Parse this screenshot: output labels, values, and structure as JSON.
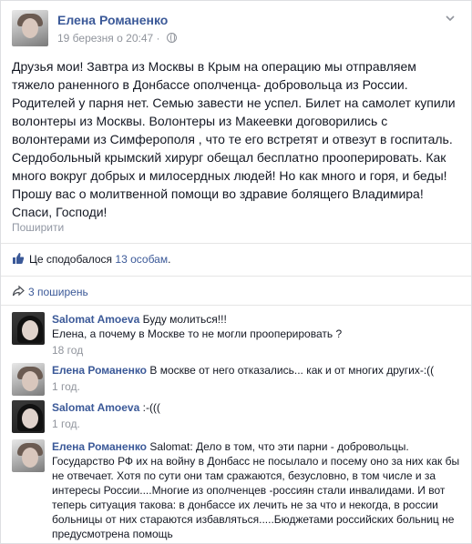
{
  "post": {
    "author": "Елена Романенко",
    "date": "19 березня о 20:47",
    "date_separator": "·",
    "text": "Друзья мои! Завтра из Москвы в Крым на операцию мы отправляем тяжело раненного в Донбассе ополченца- добровольца из России. Родителей у парня нет. Семью завести не успел. Билет на самолет купили волонтеры из Москвы. Волонтеры из Макеевки договорились с волонтерами из Симферополя , что те его встретят и отвезут в госпиталь. Сердобольный крымский хирург обещал бесплатно прооперировать. Как много вокруг добрых и милосердных людей! Но как много и горя, и беды! Прошу вас о молитвенной помощи во здравие болящего Владимира! Спаси, Господи!",
    "translate_label": "Поширити"
  },
  "likes": {
    "prefix": "Це сподобалося",
    "link": "13 особам",
    "suffix": "."
  },
  "shares": {
    "label": "3 поширень"
  },
  "comments": [
    {
      "author": "Salomat Amoeva",
      "text": "Буду молиться!!!\nЕлена, а почему в Москве то не могли прооперировать ?",
      "time": "18 год"
    },
    {
      "author": "Елена Романенко",
      "text": "В москве от него отказались... как и от многих других-:((",
      "time": "1 год."
    },
    {
      "author": "Salomat Amoeva",
      "text": ":-(((",
      "time": "1 год."
    },
    {
      "author": "Елена Романенко",
      "text": "Salomat: Дело в том, что эти парни - добровольцы. Государство РФ их на войну в Донбасс не посылало и посему оно за них как бы не отвечает. Хотя по сути они там сражаются, безусловно, в том числе и за интересы России....Многие из ополченцев -россиян стали инвалидами. И вот теперь ситуация такова: в донбассе их лечить не за что и некогда, в россии больницы от них стараются избавляться.....Бюджетами российских больниц не предусмотрена помощь",
      "time": ""
    }
  ],
  "colors": {
    "link": "#3b5998",
    "meta": "#90949c",
    "text": "#141823"
  },
  "icons": {
    "menu": "chevron-down-icon",
    "privacy": "globe-icon",
    "like": "thumbs-up-icon",
    "share": "share-icon"
  }
}
